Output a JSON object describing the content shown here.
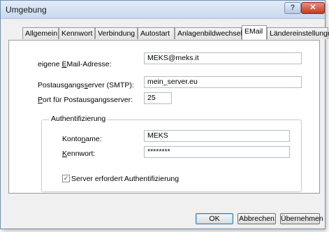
{
  "window": {
    "title": "Umgebung"
  },
  "titlebar": {
    "help_glyph": "?",
    "close_glyph": "✕"
  },
  "tabs": [
    {
      "label": "Allgemein"
    },
    {
      "label": "Kennwort"
    },
    {
      "label": "Verbindung"
    },
    {
      "label": "Autostart"
    },
    {
      "label": "Anlagenbildwechsel"
    },
    {
      "label": "EMail"
    },
    {
      "label": "Ländereinstellungen"
    }
  ],
  "active_tab": "EMail",
  "email": {
    "address_label_pre": "eigene ",
    "address_label_u": "E",
    "address_label_post": "Mail-Adresse:",
    "address_value": "MEKS@meks.it",
    "smtp_label_pre": "Postausgangs",
    "smtp_label_u": "s",
    "smtp_label_post": "erver (SMTP):",
    "smtp_value": "mein_server.eu",
    "port_label_u": "P",
    "port_label_post": "ort für Postausgangsserver:",
    "port_value": "25"
  },
  "auth": {
    "group_title": "Authentifizierung",
    "account_label_pre": "Konto",
    "account_label_u": "n",
    "account_label_post": "ame:",
    "account_value": "MEKS",
    "password_label_u": "K",
    "password_label_post": "ennwort:",
    "password_value": "********",
    "checkbox_label": "Server erfordert Authentifizierung",
    "checkbox_checked": true,
    "check_glyph": "✓"
  },
  "buttons": {
    "ok": "OK",
    "cancel": "Abbrechen",
    "apply": "Übernehmen"
  }
}
